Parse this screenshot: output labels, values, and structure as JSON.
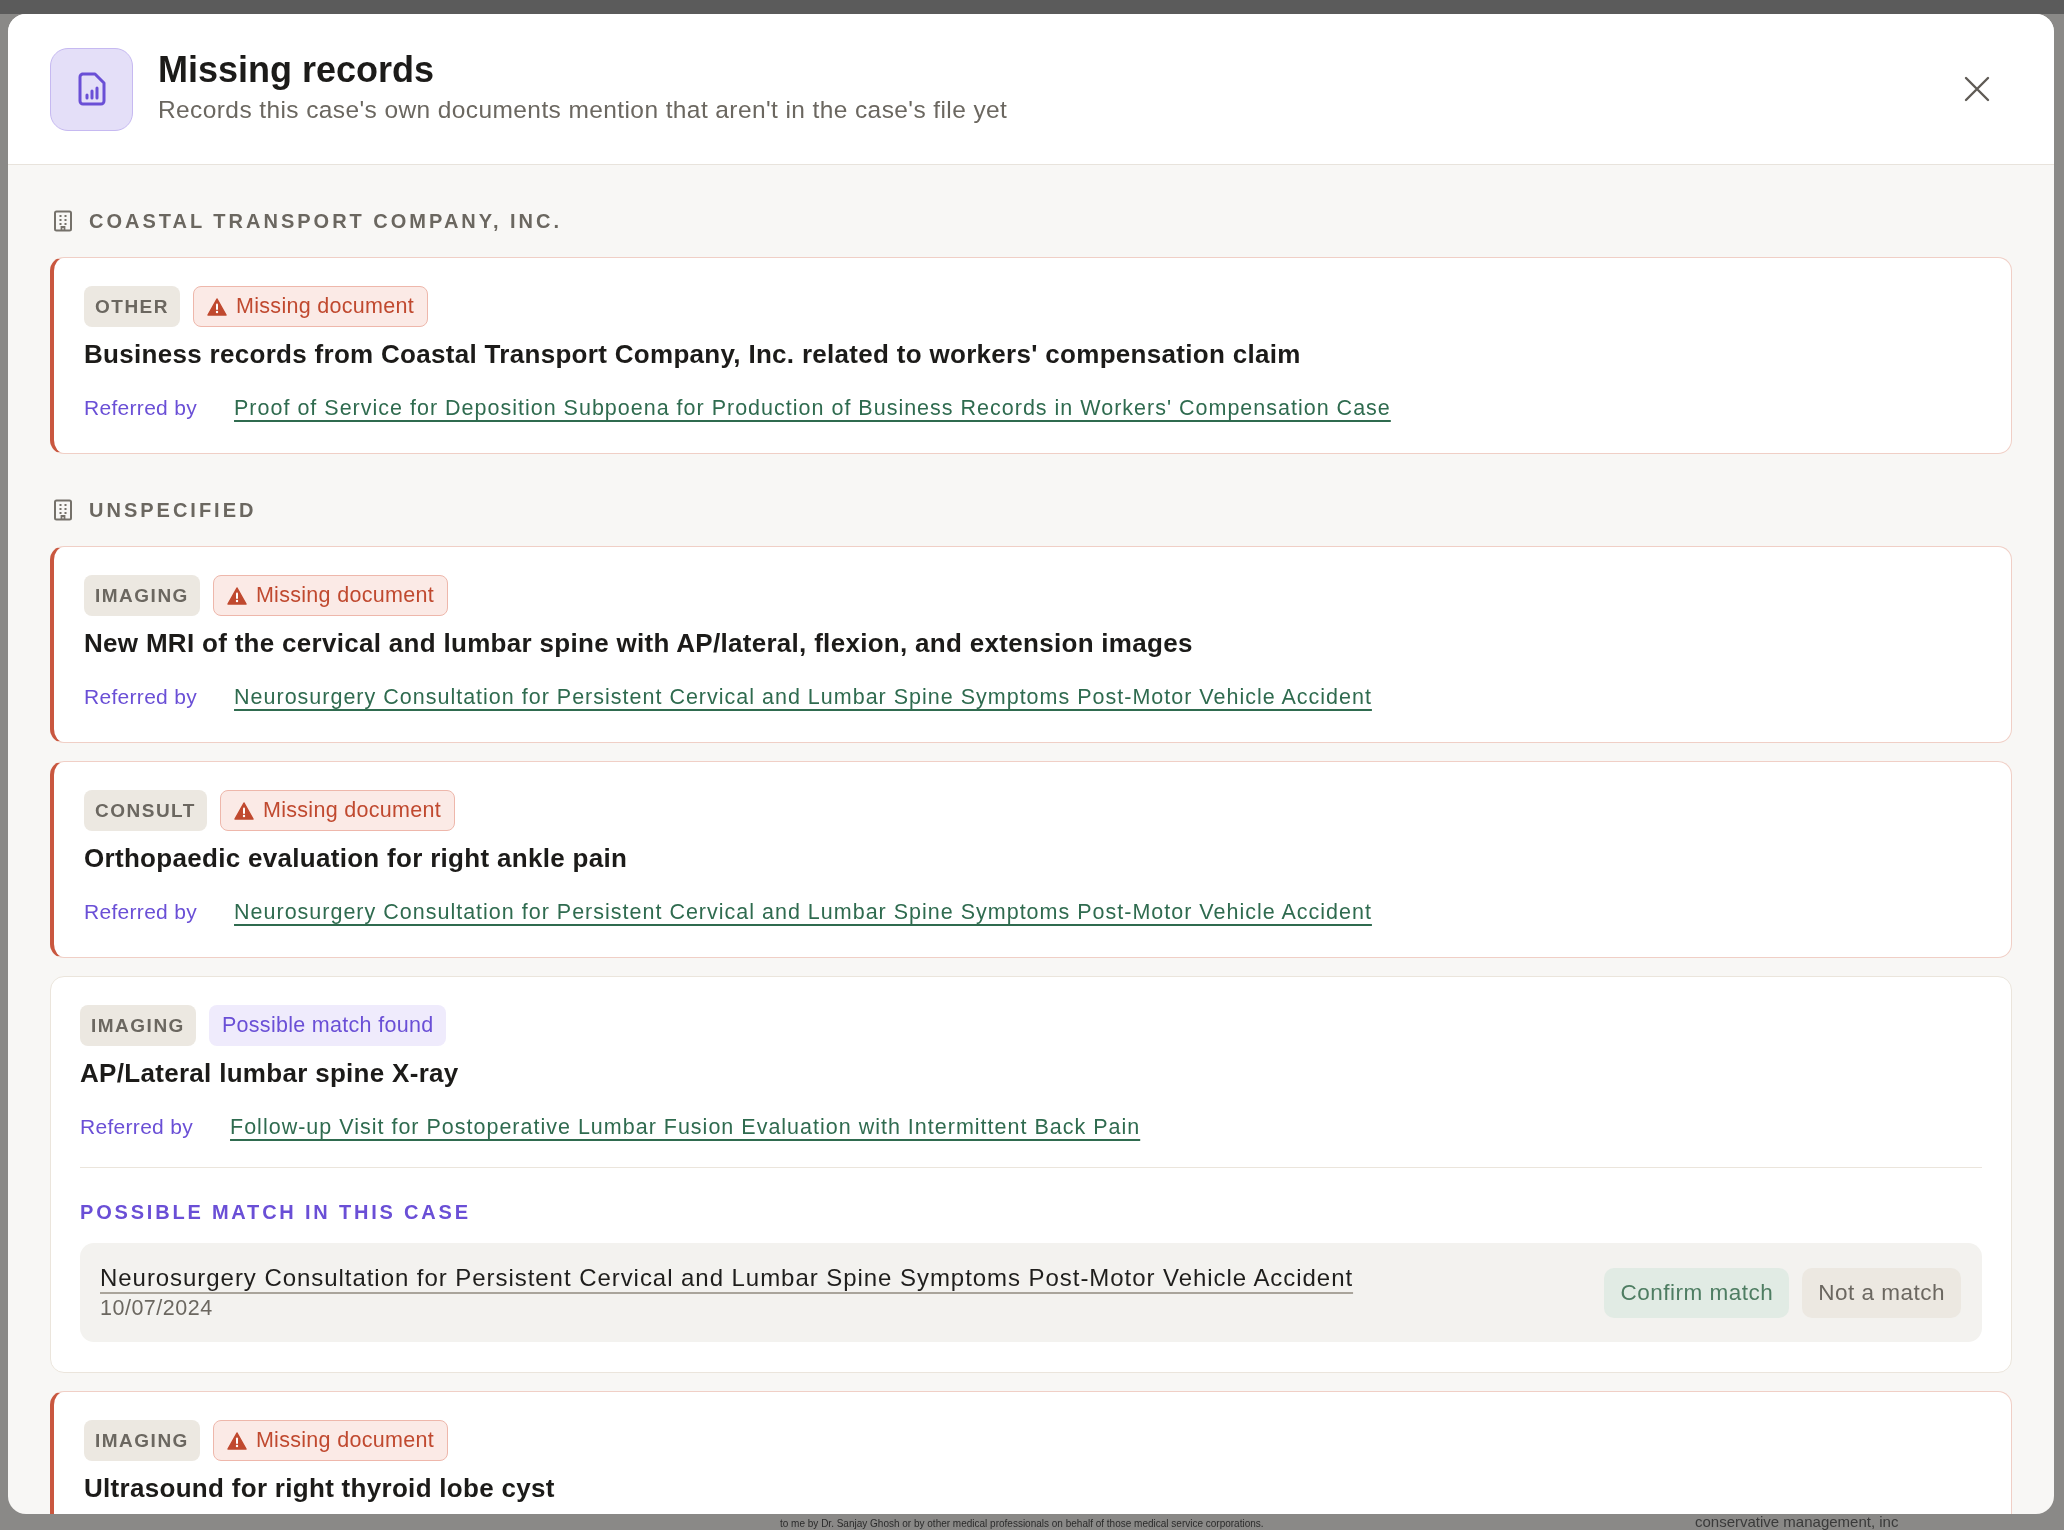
{
  "dialog": {
    "title": "Missing records",
    "subtitle": "Records this case's own documents mention that aren't in the case's file yet"
  },
  "groups": [
    {
      "name": "COASTAL TRANSPORT COMPANY, INC.",
      "records": [
        {
          "kind": "missing",
          "type": "OTHER",
          "status_label": "Missing document",
          "title": "Business records from Coastal Transport Company, Inc. related to workers' compensation claim",
          "referred_by_label": "Referred by",
          "referred_by": "Proof of Service for Deposition Subpoena for Production of Business Records in Workers' Compensation Case"
        }
      ]
    },
    {
      "name": "UNSPECIFIED",
      "records": [
        {
          "kind": "missing",
          "type": "IMAGING",
          "status_label": "Missing document",
          "title": "New MRI of the cervical and lumbar spine with AP/lateral, flexion, and extension images",
          "referred_by_label": "Referred by",
          "referred_by": "Neurosurgery Consultation for Persistent Cervical and Lumbar Spine Symptoms Post-Motor Vehicle Accident"
        },
        {
          "kind": "missing",
          "type": "CONSULT",
          "status_label": "Missing document",
          "title": "Orthopaedic evaluation for right ankle pain",
          "referred_by_label": "Referred by",
          "referred_by": "Neurosurgery Consultation for Persistent Cervical and Lumbar Spine Symptoms Post-Motor Vehicle Accident"
        },
        {
          "kind": "possible_match",
          "type": "IMAGING",
          "status_label": "Possible match found",
          "title": "AP/Lateral lumbar spine X-ray",
          "referred_by_label": "Referred by",
          "referred_by": "Follow-up Visit for Postoperative Lumbar Fusion Evaluation with Intermittent Back Pain",
          "match": {
            "heading": "POSSIBLE MATCH IN THIS CASE",
            "document": "Neurosurgery Consultation for Persistent Cervical and Lumbar Spine Symptoms Post-Motor Vehicle Accident",
            "date": "10/07/2024",
            "buttons": [
              {
                "kind": "confirm",
                "label": "Confirm match"
              },
              {
                "kind": "reject",
                "label": "Not a match"
              }
            ]
          }
        },
        {
          "kind": "missing",
          "type": "IMAGING",
          "status_label": "Missing document",
          "title": "Ultrasound for right thyroid lobe cyst"
        }
      ]
    }
  ],
  "backdrop": {
    "fragments": [
      "to me by Dr. Sanjay Ghosh or by other medical professionals on behalf of those medical service corporations.",
      "conservative management, inc"
    ]
  }
}
